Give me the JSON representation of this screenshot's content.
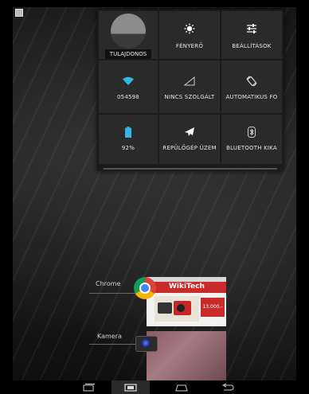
{
  "status_bar": {
    "notification_icon": "image-icon"
  },
  "quick_settings": {
    "owner": {
      "label": "TULAJDONOS"
    },
    "brightness": {
      "label": "FÉNYERŐ",
      "icon": "brightness-icon"
    },
    "settings": {
      "label": "BEÁLLÍTÁSOK",
      "icon": "settings-sliders-icon"
    },
    "wifi": {
      "label": "054598",
      "icon": "wifi-icon",
      "color": "#33b5e5"
    },
    "signal": {
      "label": "NINCS SZOLGÁLT",
      "icon": "no-signal-icon"
    },
    "rotation": {
      "label": "AUTOMATIKUS FO",
      "icon": "rotate-icon"
    },
    "battery": {
      "label": "92%",
      "icon": "battery-icon",
      "color": "#33b5e5",
      "level": 0.92
    },
    "airplane": {
      "label": "REPÜLŐGÉP ÜZEM",
      "icon": "airplane-icon"
    },
    "bluetooth": {
      "label": "BLUETOOTH KIKA",
      "icon": "bluetooth-icon"
    }
  },
  "recents": [
    {
      "app": "Chrome",
      "icon": "chrome-icon",
      "page_title": "WikiTech",
      "price_badge": "13.000.- Ft"
    },
    {
      "app": "Kamera",
      "icon": "camera-icon"
    }
  ],
  "navbar": {
    "back": "back-icon",
    "home": "home-icon",
    "recents": "recent-apps-icon",
    "screenshot": "screenshot-icon"
  }
}
